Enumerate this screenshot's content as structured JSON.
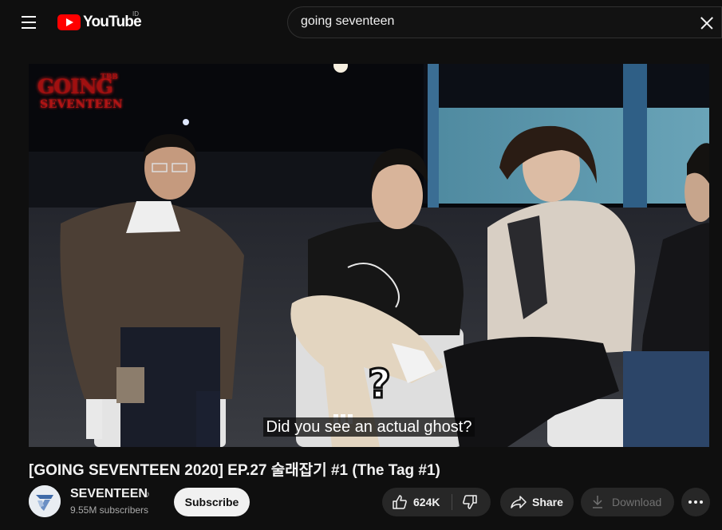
{
  "header": {
    "logo_text": "YouTube",
    "country_code": "ID",
    "search": {
      "value": "going seventeen"
    }
  },
  "player": {
    "series_logo": {
      "line1": "GOING",
      "line2": "SEVENTEEN",
      "year": "TBB"
    },
    "caption": "Did you see an actual ghost?",
    "overlay_mark": "?"
  },
  "video": {
    "title": "[GOING SEVENTEEN 2020] EP.27 술래잡기 #1 (The Tag #1)"
  },
  "channel": {
    "name": "SEVENTEEN",
    "verified_icon": "music-note-icon",
    "subscribers": "9.55M subscribers",
    "subscribe_label": "Subscribe"
  },
  "actions": {
    "like_count": "624K",
    "share_label": "Share",
    "download_label": "Download"
  },
  "colors": {
    "background": "#0f0f0f",
    "brand_red": "#ff0000",
    "pill": "#272727",
    "subscribe_bg": "#f1f1f1"
  }
}
